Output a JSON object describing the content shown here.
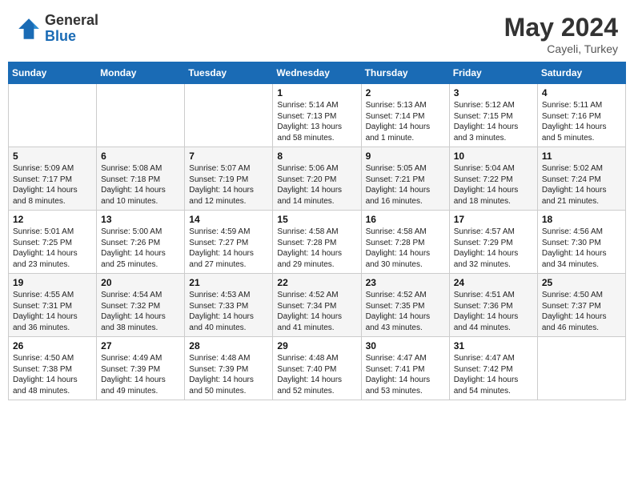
{
  "header": {
    "logo_general": "General",
    "logo_blue": "Blue",
    "month_year": "May 2024",
    "location": "Cayeli, Turkey"
  },
  "weekdays": [
    "Sunday",
    "Monday",
    "Tuesday",
    "Wednesday",
    "Thursday",
    "Friday",
    "Saturday"
  ],
  "weeks": [
    [
      null,
      null,
      null,
      {
        "day": "1",
        "sunrise": "Sunrise: 5:14 AM",
        "sunset": "Sunset: 7:13 PM",
        "daylight": "Daylight: 13 hours and 58 minutes."
      },
      {
        "day": "2",
        "sunrise": "Sunrise: 5:13 AM",
        "sunset": "Sunset: 7:14 PM",
        "daylight": "Daylight: 14 hours and 1 minute."
      },
      {
        "day": "3",
        "sunrise": "Sunrise: 5:12 AM",
        "sunset": "Sunset: 7:15 PM",
        "daylight": "Daylight: 14 hours and 3 minutes."
      },
      {
        "day": "4",
        "sunrise": "Sunrise: 5:11 AM",
        "sunset": "Sunset: 7:16 PM",
        "daylight": "Daylight: 14 hours and 5 minutes."
      }
    ],
    [
      {
        "day": "5",
        "sunrise": "Sunrise: 5:09 AM",
        "sunset": "Sunset: 7:17 PM",
        "daylight": "Daylight: 14 hours and 8 minutes."
      },
      {
        "day": "6",
        "sunrise": "Sunrise: 5:08 AM",
        "sunset": "Sunset: 7:18 PM",
        "daylight": "Daylight: 14 hours and 10 minutes."
      },
      {
        "day": "7",
        "sunrise": "Sunrise: 5:07 AM",
        "sunset": "Sunset: 7:19 PM",
        "daylight": "Daylight: 14 hours and 12 minutes."
      },
      {
        "day": "8",
        "sunrise": "Sunrise: 5:06 AM",
        "sunset": "Sunset: 7:20 PM",
        "daylight": "Daylight: 14 hours and 14 minutes."
      },
      {
        "day": "9",
        "sunrise": "Sunrise: 5:05 AM",
        "sunset": "Sunset: 7:21 PM",
        "daylight": "Daylight: 14 hours and 16 minutes."
      },
      {
        "day": "10",
        "sunrise": "Sunrise: 5:04 AM",
        "sunset": "Sunset: 7:22 PM",
        "daylight": "Daylight: 14 hours and 18 minutes."
      },
      {
        "day": "11",
        "sunrise": "Sunrise: 5:02 AM",
        "sunset": "Sunset: 7:24 PM",
        "daylight": "Daylight: 14 hours and 21 minutes."
      }
    ],
    [
      {
        "day": "12",
        "sunrise": "Sunrise: 5:01 AM",
        "sunset": "Sunset: 7:25 PM",
        "daylight": "Daylight: 14 hours and 23 minutes."
      },
      {
        "day": "13",
        "sunrise": "Sunrise: 5:00 AM",
        "sunset": "Sunset: 7:26 PM",
        "daylight": "Daylight: 14 hours and 25 minutes."
      },
      {
        "day": "14",
        "sunrise": "Sunrise: 4:59 AM",
        "sunset": "Sunset: 7:27 PM",
        "daylight": "Daylight: 14 hours and 27 minutes."
      },
      {
        "day": "15",
        "sunrise": "Sunrise: 4:58 AM",
        "sunset": "Sunset: 7:28 PM",
        "daylight": "Daylight: 14 hours and 29 minutes."
      },
      {
        "day": "16",
        "sunrise": "Sunrise: 4:58 AM",
        "sunset": "Sunset: 7:28 PM",
        "daylight": "Daylight: 14 hours and 30 minutes."
      },
      {
        "day": "17",
        "sunrise": "Sunrise: 4:57 AM",
        "sunset": "Sunset: 7:29 PM",
        "daylight": "Daylight: 14 hours and 32 minutes."
      },
      {
        "day": "18",
        "sunrise": "Sunrise: 4:56 AM",
        "sunset": "Sunset: 7:30 PM",
        "daylight": "Daylight: 14 hours and 34 minutes."
      }
    ],
    [
      {
        "day": "19",
        "sunrise": "Sunrise: 4:55 AM",
        "sunset": "Sunset: 7:31 PM",
        "daylight": "Daylight: 14 hours and 36 minutes."
      },
      {
        "day": "20",
        "sunrise": "Sunrise: 4:54 AM",
        "sunset": "Sunset: 7:32 PM",
        "daylight": "Daylight: 14 hours and 38 minutes."
      },
      {
        "day": "21",
        "sunrise": "Sunrise: 4:53 AM",
        "sunset": "Sunset: 7:33 PM",
        "daylight": "Daylight: 14 hours and 40 minutes."
      },
      {
        "day": "22",
        "sunrise": "Sunrise: 4:52 AM",
        "sunset": "Sunset: 7:34 PM",
        "daylight": "Daylight: 14 hours and 41 minutes."
      },
      {
        "day": "23",
        "sunrise": "Sunrise: 4:52 AM",
        "sunset": "Sunset: 7:35 PM",
        "daylight": "Daylight: 14 hours and 43 minutes."
      },
      {
        "day": "24",
        "sunrise": "Sunrise: 4:51 AM",
        "sunset": "Sunset: 7:36 PM",
        "daylight": "Daylight: 14 hours and 44 minutes."
      },
      {
        "day": "25",
        "sunrise": "Sunrise: 4:50 AM",
        "sunset": "Sunset: 7:37 PM",
        "daylight": "Daylight: 14 hours and 46 minutes."
      }
    ],
    [
      {
        "day": "26",
        "sunrise": "Sunrise: 4:50 AM",
        "sunset": "Sunset: 7:38 PM",
        "daylight": "Daylight: 14 hours and 48 minutes."
      },
      {
        "day": "27",
        "sunrise": "Sunrise: 4:49 AM",
        "sunset": "Sunset: 7:39 PM",
        "daylight": "Daylight: 14 hours and 49 minutes."
      },
      {
        "day": "28",
        "sunrise": "Sunrise: 4:48 AM",
        "sunset": "Sunset: 7:39 PM",
        "daylight": "Daylight: 14 hours and 50 minutes."
      },
      {
        "day": "29",
        "sunrise": "Sunrise: 4:48 AM",
        "sunset": "Sunset: 7:40 PM",
        "daylight": "Daylight: 14 hours and 52 minutes."
      },
      {
        "day": "30",
        "sunrise": "Sunrise: 4:47 AM",
        "sunset": "Sunset: 7:41 PM",
        "daylight": "Daylight: 14 hours and 53 minutes."
      },
      {
        "day": "31",
        "sunrise": "Sunrise: 4:47 AM",
        "sunset": "Sunset: 7:42 PM",
        "daylight": "Daylight: 14 hours and 54 minutes."
      },
      null
    ]
  ]
}
